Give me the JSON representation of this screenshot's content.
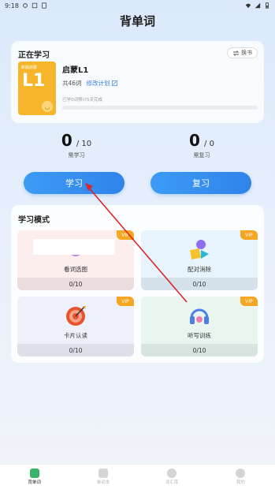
{
  "status_bar": {
    "time": "9:18"
  },
  "header": {
    "title": "背单词"
  },
  "study_card": {
    "label": "正在学习",
    "change_book": "换书",
    "cover": {
      "series": "新版启蒙",
      "level": "L1"
    },
    "book_title": "启蒙L1",
    "word_count": "共46词",
    "edit_plan": "修改计划",
    "progress_text": "已学0词预计5天完成",
    "progress": 0
  },
  "stats": {
    "learn": {
      "value": "0",
      "total": "/ 10",
      "label": "需学习"
    },
    "review": {
      "value": "0",
      "total": "/ 0",
      "label": "需复习"
    }
  },
  "buttons": {
    "learn": "学习",
    "review": "复习"
  },
  "modes": {
    "title": "学习模式",
    "items": [
      {
        "name": "看词选图",
        "count": "0/10",
        "vip": "VIP"
      },
      {
        "name": "配对消除",
        "count": "0/10",
        "vip": "VIP"
      },
      {
        "name": "卡片认读",
        "count": "0/10",
        "vip": "VIP"
      },
      {
        "name": "听写训练",
        "count": "0/10",
        "vip": "VIP"
      }
    ]
  },
  "tabs": [
    {
      "label": "背单词",
      "active": true
    },
    {
      "label": "单词本",
      "active": false
    },
    {
      "label": "词汇库",
      "active": false
    },
    {
      "label": "我的",
      "active": false
    }
  ],
  "colors": {
    "accent": "#3a8ef0",
    "vip": "#f5a623",
    "tab_active": "#3bb16e"
  }
}
